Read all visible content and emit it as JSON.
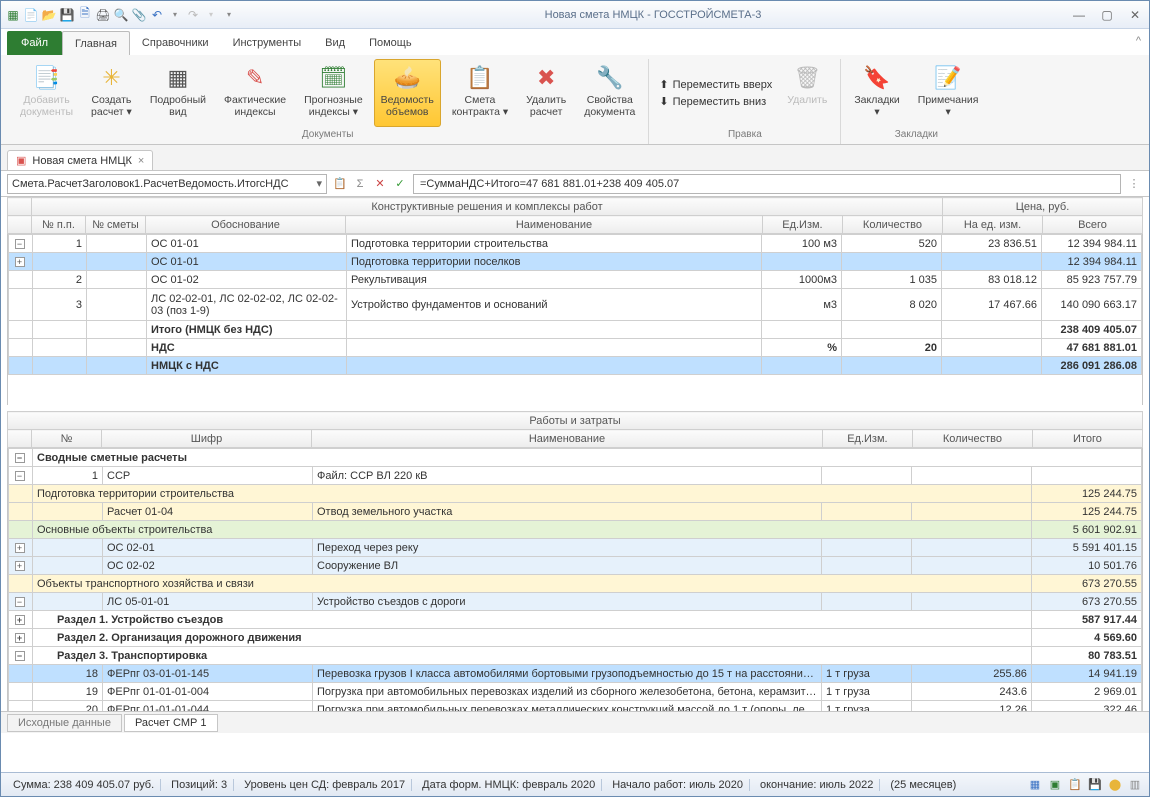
{
  "window": {
    "title": "Новая смета НМЦК - ГОССТРОЙСМЕТА-3"
  },
  "menu": {
    "file": "Файл",
    "tabs": [
      "Главная",
      "Справочники",
      "Инструменты",
      "Вид",
      "Помощь"
    ]
  },
  "ribbon": {
    "addDocs": "Добавить\nдокументы",
    "createCalc": "Создать\nрасчет ▾",
    "detailView": "Подробный\nвид",
    "factIdx": "Фактические\nиндексы",
    "progIdx": "Прогнозные\nиндексы ▾",
    "volList": "Ведомость\nобъемов",
    "contract": "Смета\nконтракта ▾",
    "delCalc": "Удалить\nрасчет",
    "docProps": "Свойства\nдокумента",
    "groupDocs": "Документы",
    "moveUp": "Переместить вверх",
    "moveDown": "Переместить вниз",
    "delete": "Удалить",
    "groupEdit": "Правка",
    "bookmarks": "Закладки\n▾",
    "notes": "Примечания\n▾",
    "groupBookmarks": "Закладки"
  },
  "docTab": "Новая смета НМЦК",
  "formula": {
    "addr": "Смета.РасчетЗаголовок1.РасчетВедомость.ИтогсНДС",
    "fx": "=СуммаНДС+Итого=47 681 881.01+238 409 405.07"
  },
  "topGrid": {
    "superHeader": {
      "left": "Конструктивные решения и комплексы работ",
      "right": "Цена, руб."
    },
    "cols": [
      "№ п.п.",
      "№ сметы",
      "Обоснование",
      "Наименование",
      "Ед.Изм.",
      "Количество",
      "На ед. изм.",
      "Всего"
    ],
    "rows": [
      {
        "n": "1",
        "code": "ОС 01-01",
        "name": "Подготовка территории строительства",
        "unit": "100 м3",
        "qty": "520",
        "uprice": "23 836.51",
        "total": "12 394 984.11",
        "exp": "-"
      },
      {
        "n": "",
        "code": "ОС 01-01",
        "name": "Подготовка территории поселков",
        "unit": "",
        "qty": "",
        "uprice": "",
        "total": "12 394 984.11",
        "sel": true,
        "exp": "+"
      },
      {
        "n": "2",
        "code": "ОС 01-02",
        "name": "Рекультивация",
        "unit": "1000м3",
        "qty": "1 035",
        "uprice": "83 018.12",
        "total": "85 923 757.79"
      },
      {
        "n": "3",
        "code": "ЛС 02-02-01, ЛС 02-02-02, ЛС 02-02-03 (поз 1-9)",
        "name": "Устройство фундаментов и оснований",
        "unit": "м3",
        "qty": "8 020",
        "uprice": "17 467.66",
        "total": "140 090 663.17",
        "tall": true
      },
      {
        "bold": true,
        "code": "Итого (НМЦК без НДС)",
        "total": "238 409 405.07"
      },
      {
        "bold": true,
        "code": "НДС",
        "unit": "%",
        "qty": "20",
        "total": "47 681 881.01"
      },
      {
        "bold": true,
        "code": "НМЦК с НДС",
        "total": "286 091 286.08",
        "sel": true
      }
    ]
  },
  "midGrid": {
    "title": "Работы и затраты",
    "cols": [
      "№",
      "Шифр",
      "Наименование",
      "Ед.Изм.",
      "Количество",
      "Итого"
    ],
    "rows": [
      {
        "type": "header",
        "text": "Сводные сметные расчеты",
        "exp": "-"
      },
      {
        "type": "row",
        "n": "1",
        "code": "ССР",
        "name": "Файл: ССР ВЛ 220 кВ",
        "exp": "-"
      },
      {
        "type": "cat",
        "cls": "yellow",
        "name": "Подготовка территории строительства",
        "total": "125 244.75"
      },
      {
        "type": "row",
        "cls": "yellow",
        "code": "Расчет 01-04",
        "name": "Отвод земельного участка",
        "total": "125 244.75"
      },
      {
        "type": "cat",
        "cls": "green",
        "name": "Основные объекты строительства",
        "total": "5 601 902.91"
      },
      {
        "type": "row",
        "cls": "lblue",
        "code": "ОС 02-01",
        "name": "Переход через реку",
        "total": "5 591 401.15",
        "exp": "+"
      },
      {
        "type": "row",
        "cls": "lblue",
        "code": "ОС 02-02",
        "name": "Сооружение ВЛ",
        "total": "10 501.76",
        "exp": "+"
      },
      {
        "type": "cat",
        "cls": "yellow",
        "name": "Объекты транспортного хозяйства и связи",
        "total": "673 270.55"
      },
      {
        "type": "row",
        "cls": "lblue",
        "code": "ЛС 05-01-01",
        "name": "Устройство съездов с дороги",
        "total": "673 270.55",
        "exp": "-"
      },
      {
        "type": "sect",
        "text": "Раздел 1. Устройство съездов",
        "total": "587 917.44",
        "exp": "+"
      },
      {
        "type": "sect",
        "text": "Раздел 2. Организация дорожного движения",
        "total": "4 569.60",
        "exp": "+"
      },
      {
        "type": "sect",
        "text": "Раздел 3. Транспортировка",
        "total": "80 783.51",
        "exp": "-"
      },
      {
        "type": "row",
        "cls": "sel",
        "n": "18",
        "code": "ФЕРпг 03-01-01-145",
        "name": "Перевозка грузов I класса автомобилями бортовыми грузоподъемностью до 15 т на расстояние д…",
        "unit": "1 т груза",
        "qty": "255.86",
        "total": "14 941.19"
      },
      {
        "type": "row",
        "n": "19",
        "code": "ФЕРпг 01-01-01-004",
        "name": "Погрузка при автомобильных перевозках изделий из сборного железобетона, бетона, керамзито…",
        "unit": "1 т груза",
        "qty": "243.6",
        "total": "2 969.01"
      },
      {
        "type": "row",
        "n": "20",
        "code": "ФЕРпг 01-01-01-044",
        "name": "Погрузка при автомобильных перевозках металлических конструкций массой до 1 т (опоры, лед…",
        "unit": "1 т груза",
        "qty": "12.26",
        "total": "322.46"
      }
    ]
  },
  "footTabs": [
    "Исходные данные",
    "Расчет СМР 1"
  ],
  "status": {
    "sum": "Сумма: 238 409 405.07 руб.",
    "pos": "Позиций:   3",
    "level": "Уровень цен СД: февраль 2017",
    "formDate": "Дата форм. НМЦК: февраль 2020",
    "start": "Начало работ: июль 2020",
    "end": "окончание: июль 2022",
    "months": "(25 месяцев)"
  }
}
